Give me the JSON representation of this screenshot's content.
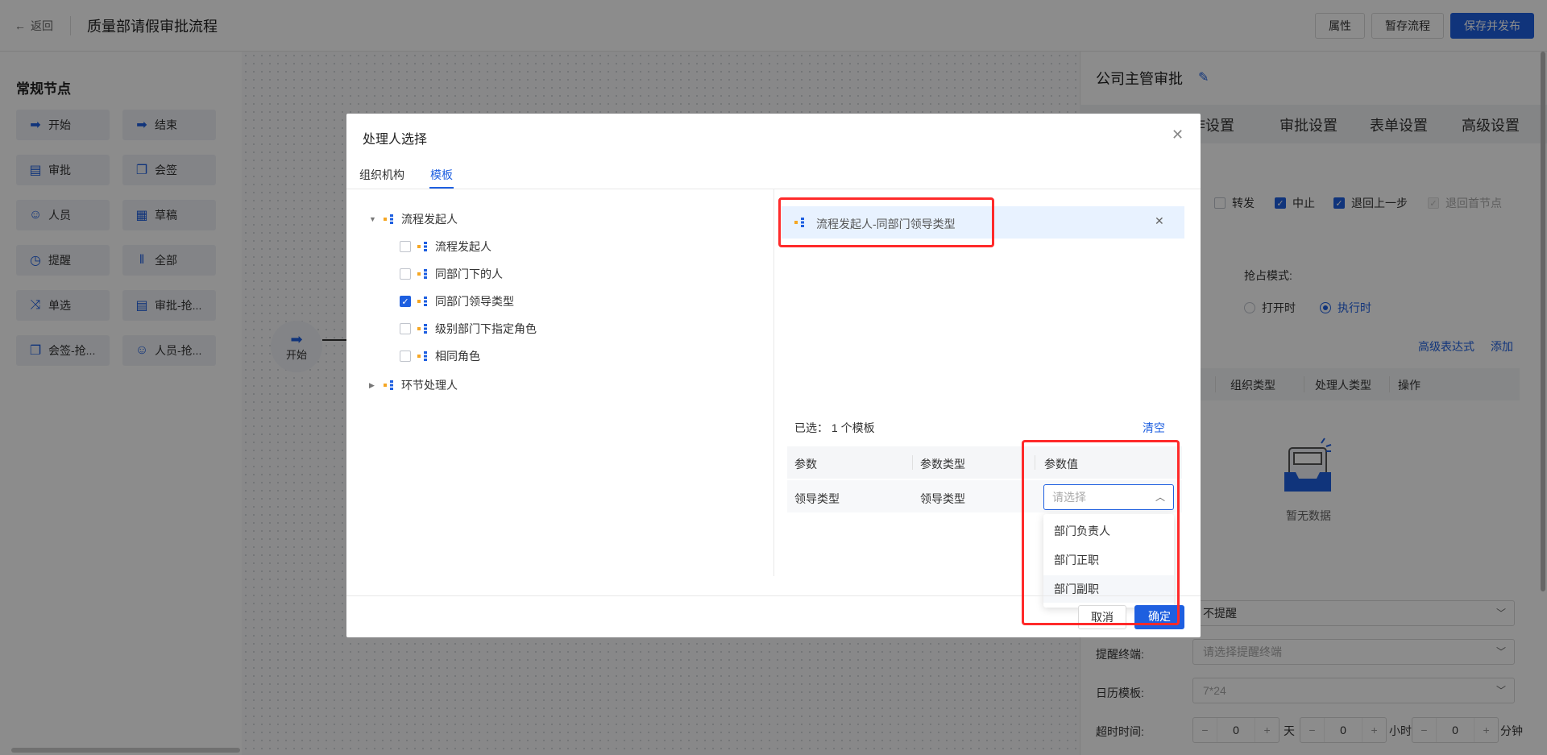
{
  "header": {
    "back_label": "返回",
    "title": "质量部请假审批流程",
    "buttons": [
      "属性",
      "暂存流程",
      "保存并发布"
    ]
  },
  "palette": {
    "title": "常规节点",
    "nodes": [
      {
        "label": "开始",
        "icon": "arrow-right-icon"
      },
      {
        "label": "结束",
        "icon": "arrow-right-stop-icon"
      },
      {
        "label": "审批",
        "icon": "document-icon"
      },
      {
        "label": "会签",
        "icon": "stacked-docs-icon"
      },
      {
        "label": "人员",
        "icon": "user-icon"
      },
      {
        "label": "草稿",
        "icon": "draft-icon"
      },
      {
        "label": "提醒",
        "icon": "alarm-icon"
      },
      {
        "label": "全部",
        "icon": "parallel-icon"
      },
      {
        "label": "单选",
        "icon": "shuffle-icon"
      },
      {
        "label": "审批-抢...",
        "icon": "document-icon"
      },
      {
        "label": "会签-抢...",
        "icon": "stacked-docs-icon"
      },
      {
        "label": "人员-抢...",
        "icon": "user-icon"
      }
    ]
  },
  "canvas": {
    "start_node_label": "开始"
  },
  "right_panel": {
    "title": "公司主管审批",
    "tabs": [
      "作设置",
      "审批设置",
      "表单设置",
      "高级设置"
    ],
    "checkboxes": [
      {
        "label": "转发",
        "checked": false
      },
      {
        "label": "中止",
        "checked": true
      },
      {
        "label": "退回上一步",
        "checked": true
      },
      {
        "label": "退回首节点",
        "checked": true,
        "disabled": true
      }
    ],
    "grab_mode_label": "抢占模式:",
    "radios": [
      {
        "label": "打开时",
        "selected": false
      },
      {
        "label": "执行时",
        "selected": true
      }
    ],
    "links": [
      "高级表达式",
      "添加"
    ],
    "table_headers": [
      "组织类型",
      "处理人类型",
      "操作"
    ],
    "empty_text": "暂无数据",
    "remind_value": "不提醒",
    "remind_terminal_label": "提醒终端:",
    "remind_terminal_placeholder": "请选择提醒终端",
    "calendar_label": "日历模板:",
    "calendar_value": "7*24",
    "timeout_label": "超时时间:",
    "timeout": [
      {
        "minus": "−",
        "value": "0",
        "plus": "+",
        "unit": "天"
      },
      {
        "minus": "−",
        "value": "0",
        "plus": "+",
        "unit": "小时"
      },
      {
        "minus": "−",
        "value": "0",
        "plus": "+",
        "unit": "分钟"
      }
    ]
  },
  "modal": {
    "title": "处理人选择",
    "tabs": [
      "组织机构",
      "模板"
    ],
    "active_tab": "模板",
    "tree": {
      "root1": "流程发起人",
      "children": [
        {
          "label": "流程发起人",
          "checked": false
        },
        {
          "label": "同部门下的人",
          "checked": false
        },
        {
          "label": "同部门领导类型",
          "checked": true
        },
        {
          "label": "级别部门下指定角色",
          "checked": false
        },
        {
          "label": "相同角色",
          "checked": false
        }
      ],
      "root2": "环节处理人"
    },
    "selected_item": "流程发起人-同部门领导类型",
    "chosen_prefix": "已选：",
    "chosen_count": "1 个模板",
    "clear_label": "清空",
    "param_headers": [
      "参数",
      "参数类型",
      "参数值"
    ],
    "param_row": {
      "param": "领导类型",
      "type": "领导类型",
      "value_placeholder": "请选择"
    },
    "dropdown_options": [
      "部门负责人",
      "部门正职",
      "部门副职"
    ],
    "cancel_label": "取消",
    "confirm_label": "确定"
  },
  "colors": {
    "accent": "#1e5fe0",
    "highlight": "#ff2a2a",
    "selected_bg": "#e8f2ff"
  }
}
